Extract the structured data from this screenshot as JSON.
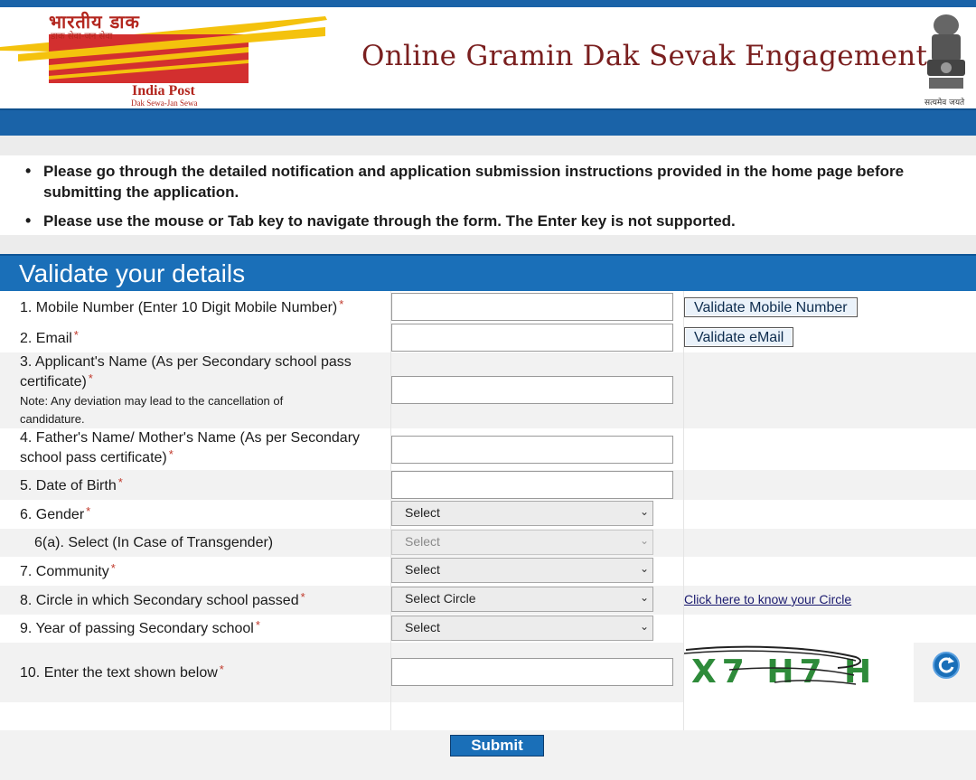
{
  "header": {
    "logo_hindi": "भारतीय डाक",
    "logo_hindi_sub": "डाक सेवा-जन सेवा",
    "logo_name": "India Post",
    "logo_tagline": "Dak Sewa-Jan Sewa",
    "title": "Online Gramin Dak Sevak Engagement",
    "emblem_motto": "सत्यमेव जयते"
  },
  "instructions": [
    "Please go through the detailed notification and application submission instructions provided in the home page before submitting the application.",
    "Please use the mouse or Tab key to navigate through the form. The Enter key is not supported."
  ],
  "section": {
    "title": "Validate your details"
  },
  "form": {
    "mobile": {
      "label": "1. Mobile Number (Enter 10 Digit Mobile Number)",
      "required": "*",
      "value": "",
      "button": "Validate Mobile Number"
    },
    "email": {
      "label": "2. Email",
      "required": "*",
      "value": "",
      "button": "Validate eMail"
    },
    "applicant_name": {
      "label_line1": "3. Applicant's Name (As per Secondary school pass",
      "label_line2": "certificate)",
      "required": "*",
      "note_line1": "Note: Any deviation may lead to the cancellation of",
      "note_line2": "candidature.",
      "value": ""
    },
    "parent_name": {
      "label_line1": "4. Father's Name/ Mother's Name (As per Secondary",
      "label_line2": "school pass certificate)",
      "required": "*",
      "value": ""
    },
    "dob": {
      "label": "5. Date of Birth",
      "required": "*",
      "value": ""
    },
    "gender": {
      "label": "6. Gender",
      "required": "*",
      "selected": "Select"
    },
    "transgender": {
      "label": "6(a). Select (In Case of Transgender)",
      "selected": "Select"
    },
    "community": {
      "label": "7. Community",
      "required": "*",
      "selected": "Select"
    },
    "circle": {
      "label": "8. Circle in which Secondary school passed",
      "required": "*",
      "selected": "Select Circle",
      "link": "Click here to know your Circle"
    },
    "year_passing": {
      "label": "9. Year of passing Secondary school",
      "required": "*",
      "selected": "Select"
    },
    "captcha": {
      "label": "10. Enter the text shown below",
      "required": "*",
      "value": "",
      "captcha_text": "X7 H7 H"
    },
    "submit_label": "Submit"
  },
  "colors": {
    "brand_blue": "#1a6fb8",
    "title_maroon": "#7a1f1f",
    "logo_red": "#b3261e",
    "logo_yellow": "#f4c20d",
    "required_red": "#c0392b",
    "captcha_green": "#2e8b3a"
  },
  "icons": {
    "refresh": "refresh-icon",
    "dropdown": "chevron-down-icon"
  }
}
